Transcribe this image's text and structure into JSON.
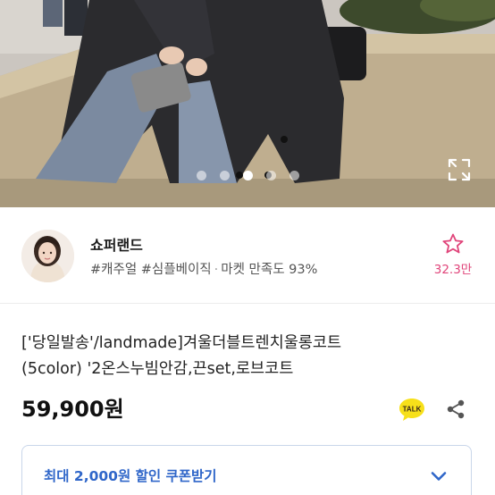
{
  "gallery": {
    "total_images": 5,
    "current_index": 3,
    "expand_icon": "expand-icon"
  },
  "shop": {
    "name": "쇼퍼랜드",
    "tags": [
      "#캐주얼",
      "#심플베이직"
    ],
    "tags_separator": "·",
    "satisfaction": "마켓 만족도 93%",
    "favorite_icon": "star-outline-icon",
    "favorite_count": "32.3만"
  },
  "product": {
    "title_line1": "['당일발송'/landmade]겨울더블트렌치울롱코트",
    "title_line2": "(5color) '2온스누빔안감,끈set,로브코트",
    "price": "59,900원",
    "talk_label": "TALK",
    "share_icon": "share-icon"
  },
  "coupon": {
    "label": "최대 2,000원 할인 쿠폰받기",
    "chevron_icon": "chevron-down-icon"
  },
  "colors": {
    "accent_pink": "#e0447a",
    "coupon_blue": "#2f66c9",
    "talk_yellow": "#f7e01a"
  }
}
